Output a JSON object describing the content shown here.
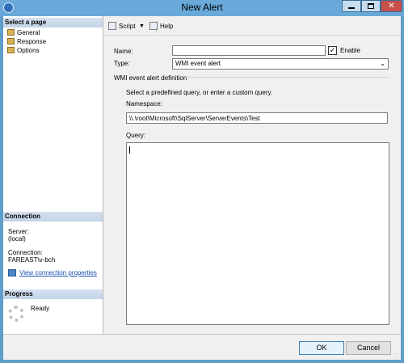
{
  "window": {
    "title": "New Alert"
  },
  "left_panel": {
    "select_page": {
      "header": "Select a page",
      "items": [
        {
          "label": "General",
          "icon": "page-icon"
        },
        {
          "label": "Response",
          "icon": "page-icon"
        },
        {
          "label": "Options",
          "icon": "page-icon"
        }
      ]
    },
    "connection": {
      "header": "Connection",
      "server_label": "Server:",
      "server_value": "(local)",
      "connection_label": "Connection:",
      "connection_value": "FAREAST\\v-bch",
      "view_link": "View connection properties"
    },
    "progress": {
      "header": "Progress",
      "status": "Ready"
    }
  },
  "toolbar": {
    "script_label": "Script",
    "help_label": "Help"
  },
  "form": {
    "name_label": "Name:",
    "name_value": "",
    "enable_label": "Enable",
    "enable_checked": true,
    "type_label": "Type:",
    "type_value": "WMI event alert",
    "group_title": "WMI event alert definition",
    "instruction": "Select a predefined query, or enter a custom query.",
    "namespace_label": "Namespace:",
    "namespace_value": "\\\\.\\root\\Microsoft\\SqlServer\\ServerEvents\\Test",
    "query_label": "Query:",
    "query_value": ""
  },
  "buttons": {
    "ok": "OK",
    "cancel": "Cancel"
  }
}
